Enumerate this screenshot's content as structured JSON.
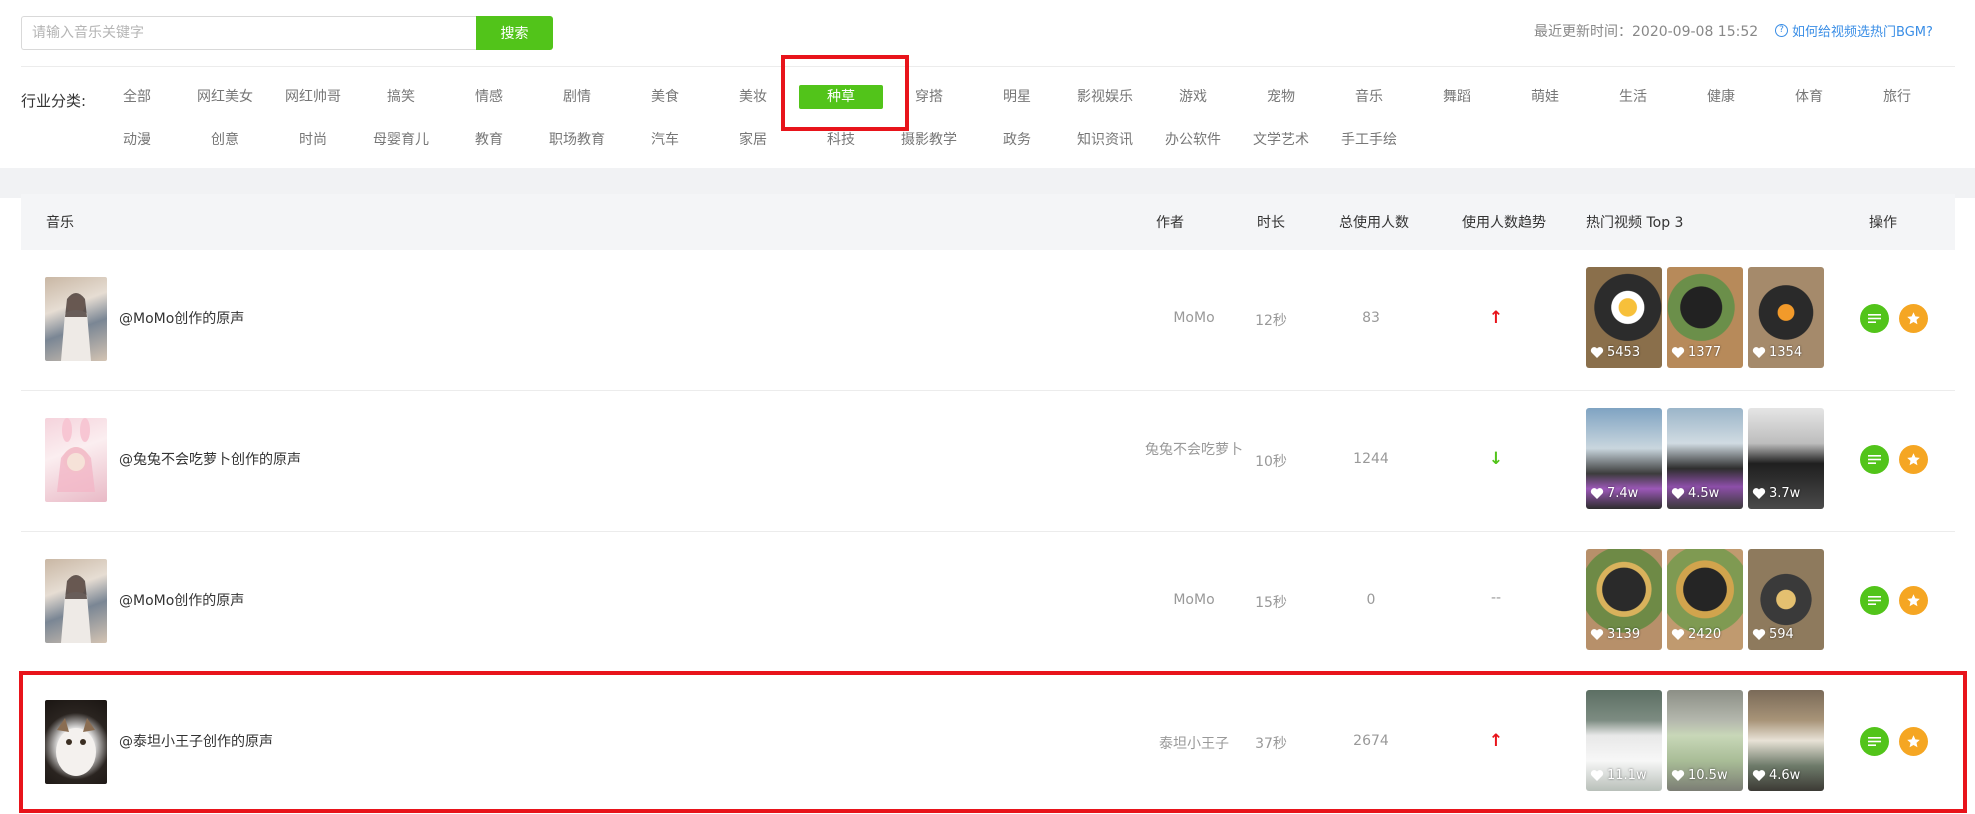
{
  "search": {
    "placeholder": "请输入音乐关键字",
    "button_label": "搜索"
  },
  "header": {
    "update_time": "最近更新时间：2020-09-08 15:52",
    "help_link": "如何给视频选热门BGM?"
  },
  "categories": {
    "label": "行业分类:",
    "row1": [
      "全部",
      "网红美女",
      "网红帅哥",
      "搞笑",
      "情感",
      "剧情",
      "美食",
      "美妆",
      "种草",
      "穿搭",
      "明星",
      "影视娱乐",
      "游戏",
      "宠物",
      "音乐",
      "舞蹈",
      "萌娃",
      "生活",
      "健康",
      "体育",
      "旅行"
    ],
    "row2": [
      "动漫",
      "创意",
      "时尚",
      "母婴育儿",
      "教育",
      "职场教育",
      "汽车",
      "家居",
      "科技",
      "摄影教学",
      "政务",
      "知识资讯",
      "办公软件",
      "文学艺术",
      "手工手绘"
    ],
    "active": "种草"
  },
  "table": {
    "headers": {
      "music": "音乐",
      "author": "作者",
      "duration": "时长",
      "users": "总使用人数",
      "trend": "使用人数趋势",
      "top3": "热门视频 Top 3",
      "ops": "操作"
    },
    "rows": [
      {
        "name": "@MoMo创作的原声",
        "author": "MoMo",
        "duration": "12秒",
        "users": "83",
        "trend": "↑",
        "trend_dir": "up",
        "videos": [
          {
            "likes": "5453"
          },
          {
            "likes": "1377"
          },
          {
            "likes": "1354"
          }
        ]
      },
      {
        "name": "@兔兔不会吃萝卜创作的原声",
        "author": "兔兔不会吃萝卜",
        "duration": "10秒",
        "users": "1244",
        "trend": "↓",
        "trend_dir": "down",
        "videos": [
          {
            "likes": "7.4w"
          },
          {
            "likes": "4.5w"
          },
          {
            "likes": "3.7w"
          }
        ]
      },
      {
        "name": "@MoMo创作的原声",
        "author": "MoMo",
        "duration": "15秒",
        "users": "0",
        "trend": "--",
        "trend_dir": "flat",
        "videos": [
          {
            "likes": "3139"
          },
          {
            "likes": "2420"
          },
          {
            "likes": "594"
          }
        ]
      },
      {
        "name": "@泰坦小王子创作的原声",
        "author": "泰坦小王子",
        "duration": "37秒",
        "users": "2674",
        "trend": "↑",
        "trend_dir": "up",
        "videos": [
          {
            "likes": "11.1w"
          },
          {
            "likes": "10.5w"
          },
          {
            "likes": "4.6w"
          }
        ]
      }
    ]
  },
  "colors": {
    "accent": "#52c41a",
    "star": "#f5a623",
    "highlight": "#e8141b",
    "link": "#3a8ee6"
  },
  "icons": {
    "list_button": "list-icon",
    "star_button": "star-icon",
    "like": "heart-icon",
    "help": "help-icon"
  }
}
